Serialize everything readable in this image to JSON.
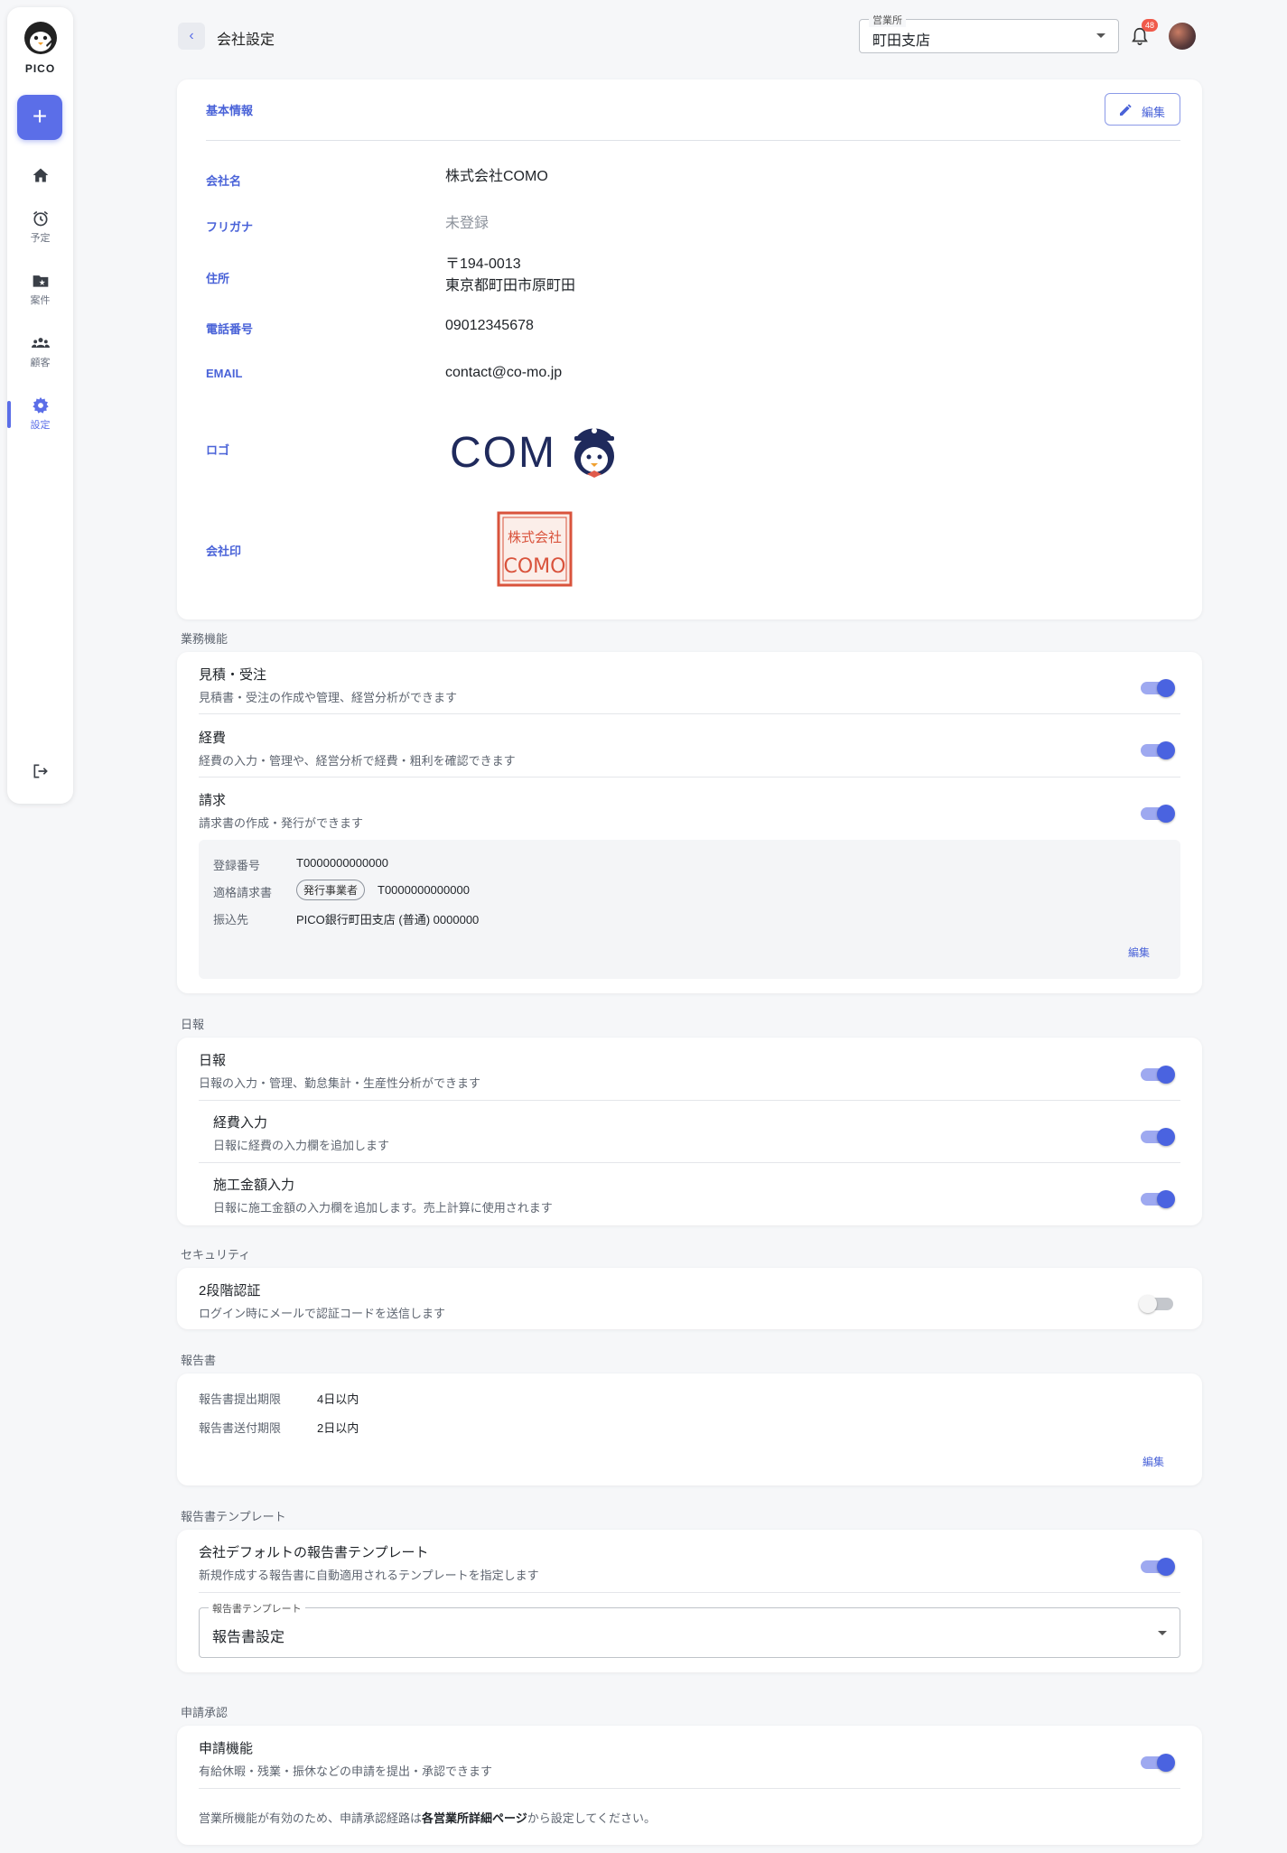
{
  "sidebar": {
    "brand": "PICO",
    "add_label": "+",
    "nav": [
      {
        "label": "",
        "icon": "home-icon"
      },
      {
        "label": "予定",
        "icon": "alarm-clock-icon"
      },
      {
        "label": "案件",
        "icon": "folder-star-icon"
      },
      {
        "label": "顧客",
        "icon": "people-icon"
      },
      {
        "label": "設定",
        "icon": "gear-icon",
        "active": true
      }
    ]
  },
  "header": {
    "title": "会社設定",
    "office_label": "営業所",
    "office_value": "町田支店",
    "notification_count": "48"
  },
  "basic_info": {
    "heading": "基本情報",
    "edit_label": "編集",
    "company_name_key": "会社名",
    "company_name": "株式会社COMO",
    "furigana_key": "フリガナ",
    "furigana": "未登録",
    "address_key": "住所",
    "postal": "〒194-0013",
    "address": "東京都町田市原町田",
    "phone_key": "電話番号",
    "phone": "09012345678",
    "email_key": "EMAIL",
    "email": "contact@co-mo.jp",
    "logo_key": "ロゴ",
    "logo_text": "COMO",
    "seal_key": "会社印",
    "seal_text_top": "株式会社",
    "seal_text_bottom": "COMO"
  },
  "business": {
    "section": "業務機能",
    "features": [
      {
        "title": "見積・受注",
        "desc": "見積書・受注の作成や管理、経営分析ができます",
        "enabled": true
      },
      {
        "title": "経費",
        "desc": "経費の入力・管理や、経営分析で経費・粗利を確認できます",
        "enabled": true
      },
      {
        "title": "請求",
        "desc": "請求書の作成・発行ができます",
        "enabled": true
      }
    ],
    "invoice": {
      "reg_no_key": "登録番号",
      "reg_no": "T0000000000000",
      "qualified_key": "適格請求書",
      "qualified_chip": "発行事業者",
      "qualified_value": "T0000000000000",
      "bank_key": "振込先",
      "bank": "PICO銀行町田支店 (普通) 0000000",
      "edit_label": "編集"
    }
  },
  "daily": {
    "section": "日報",
    "features": [
      {
        "title": "日報",
        "desc": "日報の入力・管理、勤怠集計・生産性分析ができます",
        "enabled": true
      },
      {
        "title": "経費入力",
        "desc": "日報に経費の入力欄を追加します",
        "enabled": true
      },
      {
        "title": "施工金額入力",
        "desc": "日報に施工金額の入力欄を追加します。売上計算に使用されます",
        "enabled": true
      }
    ]
  },
  "security": {
    "section": "セキュリティ",
    "title": "2段階認証",
    "desc": "ログイン時にメールで認証コードを送信します",
    "enabled": false
  },
  "report": {
    "section": "報告書",
    "deadline_key": "報告書提出期限",
    "deadline": "4日以内",
    "send_key": "報告書送付期限",
    "send": "2日以内",
    "edit_label": "編集"
  },
  "template": {
    "section": "報告書テンプレート",
    "title": "会社デフォルトの報告書テンプレート",
    "desc": "新規作成する報告書に自動適用されるテンプレートを指定します",
    "enabled": true,
    "select_label": "報告書テンプレート",
    "select_value": "報告書設定"
  },
  "approval": {
    "section": "申請承認",
    "title": "申請機能",
    "desc": "有給休暇・残業・振休などの申請を提出・承認できます",
    "enabled": true,
    "note_before": "営業所機能が有効のため、申請承認経路は",
    "note_bold": "各営業所詳細ページ",
    "note_after": "から設定してください。"
  }
}
